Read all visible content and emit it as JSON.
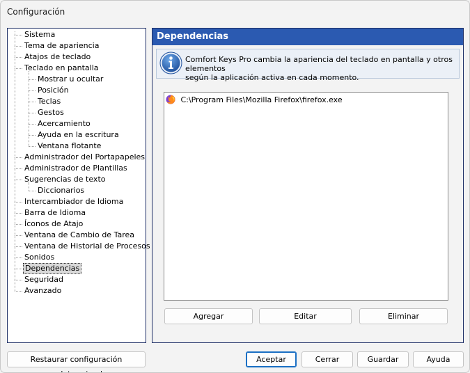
{
  "window": {
    "title": "Configuración"
  },
  "tree": {
    "items": [
      {
        "label": "Sistema",
        "level": 0
      },
      {
        "label": "Tema de apariencia",
        "level": 0
      },
      {
        "label": "Atajos de teclado",
        "level": 0
      },
      {
        "label": "Teclado en pantalla",
        "level": 0
      },
      {
        "label": "Mostrar u ocultar",
        "level": 1
      },
      {
        "label": "Posición",
        "level": 1
      },
      {
        "label": "Teclas",
        "level": 1
      },
      {
        "label": "Gestos",
        "level": 1
      },
      {
        "label": "Acercamiento",
        "level": 1
      },
      {
        "label": "Ayuda en la escritura",
        "level": 1
      },
      {
        "label": "Ventana flotante",
        "level": 1
      },
      {
        "label": "Administrador del Portapapeles",
        "level": 0
      },
      {
        "label": "Administrador de Plantillas",
        "level": 0
      },
      {
        "label": "Sugerencias de texto",
        "level": 0
      },
      {
        "label": "Diccionarios",
        "level": 1
      },
      {
        "label": "Intercambiador de Idioma",
        "level": 0
      },
      {
        "label": "Barra de Idioma",
        "level": 0
      },
      {
        "label": "Íconos de Atajo",
        "level": 0
      },
      {
        "label": "Ventana de Cambio de Tarea",
        "level": 0
      },
      {
        "label": "Ventana de Historial de Procesos",
        "level": 0
      },
      {
        "label": "Sonidos",
        "level": 0
      },
      {
        "label": "Dependencias",
        "level": 0,
        "selected": true
      },
      {
        "label": "Seguridad",
        "level": 0
      },
      {
        "label": "Avanzado",
        "level": 0
      }
    ]
  },
  "panel": {
    "title": "Dependencias",
    "info_line1": "Comfort Keys Pro cambia la apariencia del teclado en pantalla y otros elementos",
    "info_line2": "según la aplicación activa en cada momento.",
    "apps": [
      {
        "path": "C:\\Program Files\\Mozilla Firefox\\firefox.exe",
        "icon": "firefox-icon"
      }
    ],
    "add_label": "Agregar",
    "edit_label": "Editar",
    "delete_label": "Eliminar"
  },
  "footer": {
    "restore_label": "Restaurar configuración predeterminada",
    "accept_label": "Aceptar",
    "close_label": "Cerrar",
    "save_label": "Guardar",
    "help_label": "Ayuda"
  },
  "colors": {
    "header_blue": "#2b5ab1",
    "border_navy": "#1e2f66",
    "info_bg": "#ebf0f7",
    "selected_bg": "#d9d9d9"
  }
}
